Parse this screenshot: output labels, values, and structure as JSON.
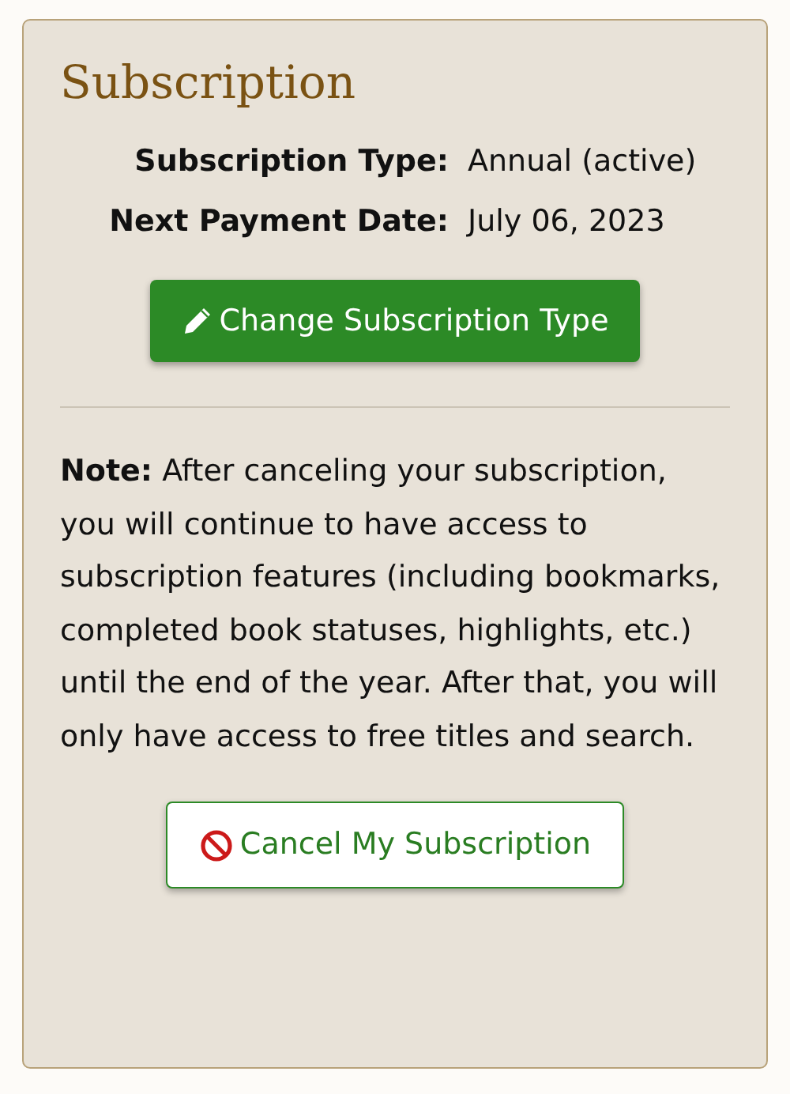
{
  "card": {
    "title": "Subscription",
    "details": [
      {
        "label": "Subscription Type:",
        "value": "Annual (active)"
      },
      {
        "label": "Next Payment Date:",
        "value": "July 06, 2023"
      }
    ],
    "change_button": {
      "label": "Change Subscription Type"
    },
    "note": "**Note:** After canceling your subscription, you will continue to have access to subscription features (including bookmarks, completed book statuses, highlights, etc.) until the end of the year. After that, you will only have access to free titles and search.",
    "cancel_button": {
      "label": "Cancel My Subscription"
    }
  }
}
